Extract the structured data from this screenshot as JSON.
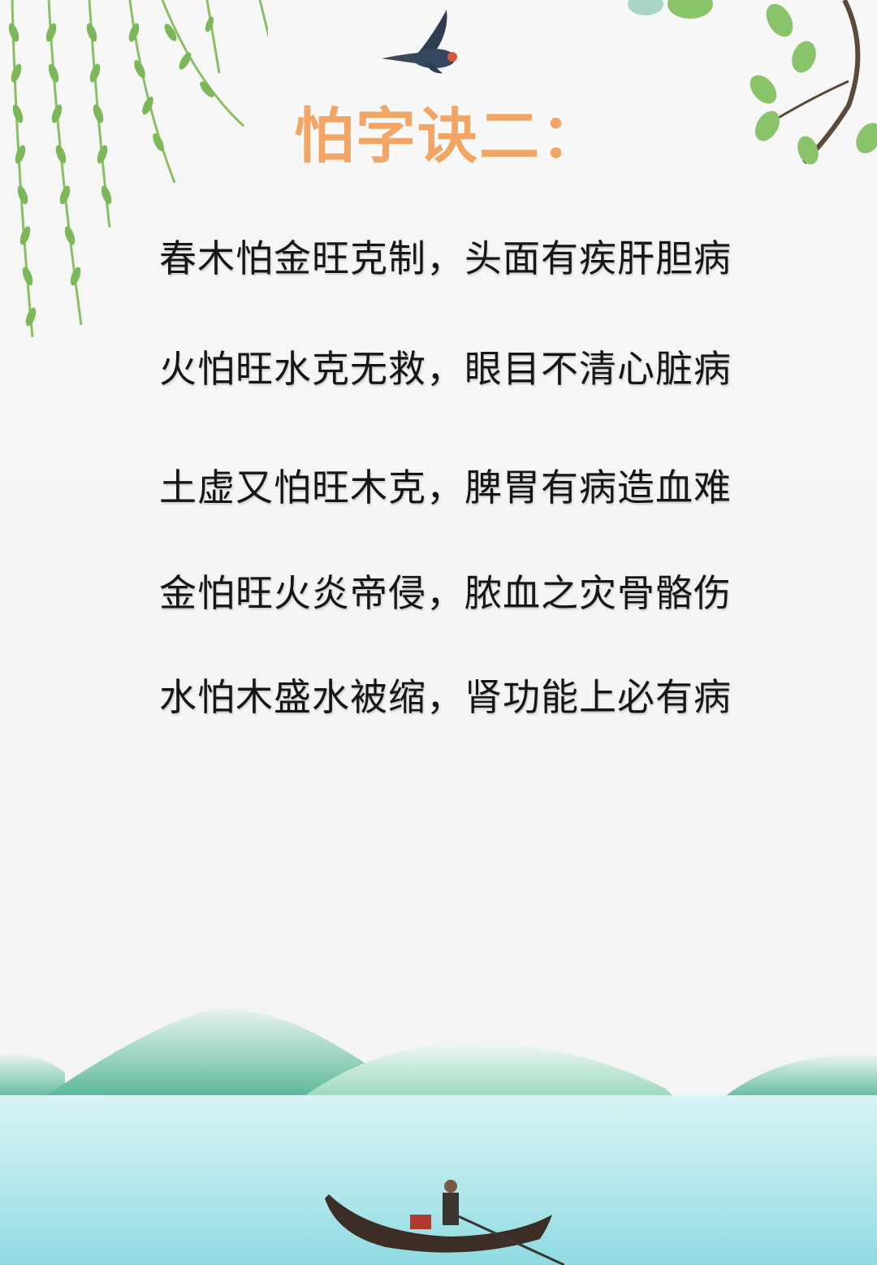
{
  "title": "怕字诀二：",
  "verses": [
    "春木怕金旺克制，头面有疾肝胆病",
    "火怕旺水克无救，眼目不清心脏病",
    "土虚又怕旺木克，脾胃有病造血难",
    "金怕旺火炎帝侵，脓血之灾骨骼伤",
    "水怕木盛水被缩，肾功能上必有病"
  ],
  "colors": {
    "title": "#f2a565",
    "verse": "#161616",
    "background": "#f5f5f5",
    "willow": "#7cb85a",
    "mountain": "#5fbf9c",
    "water": "#bfeef0"
  },
  "icons": [
    "willow-branches",
    "swallow-bird",
    "leafy-branch",
    "green-mountains",
    "lake-water",
    "boat-with-rower"
  ]
}
